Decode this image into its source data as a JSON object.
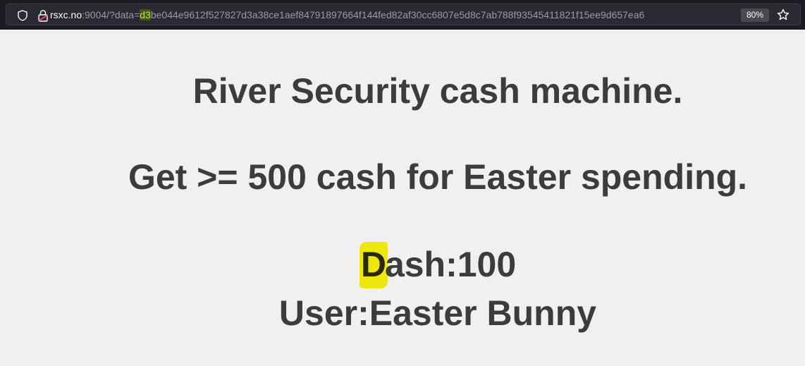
{
  "browser": {
    "url_host": "rsxc.no",
    "url_rest_before_highlight": ":9004/?data=",
    "url_highlight": "d3",
    "url_rest_after_highlight": "be044e9612f527827d3a38ce1aef84791897664f144fed82af30cc6807e5d8c7ab788f93545411821f15ee9d657ea6",
    "zoom_label": "80%",
    "icons": [
      "shield-icon",
      "lock-icon",
      "star-icon"
    ]
  },
  "page": {
    "title": "River Security cash machine.",
    "subtitle": "Get >= 500 cash for Easter spending.",
    "cash_highlighted_letter": "D",
    "cash_rest": "ash:100",
    "user_line": "User:Easter Bunny",
    "highlight_color": "#eee80a"
  }
}
